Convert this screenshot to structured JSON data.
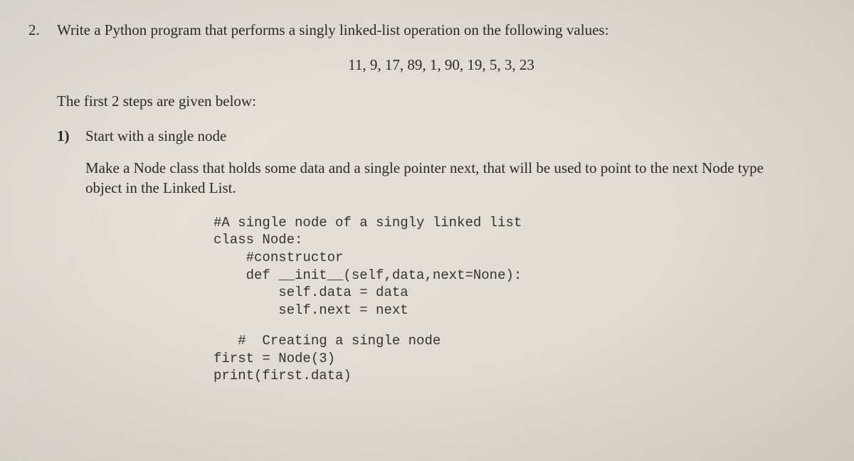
{
  "question": {
    "number": "2.",
    "text": "Write a Python program that performs a singly linked-list operation on the following values:"
  },
  "values": "11, 9, 17, 89, 1, 90, 19, 5, 3, 23",
  "intro": "The first 2 steps are given below:",
  "step1": {
    "number": "1)",
    "title": "Start with a single node",
    "description": "Make a Node class that holds some data and a single pointer next, that will be used to point to the next Node type object in the Linked List."
  },
  "code1": "#A single node of a singly linked list\nclass Node:\n    #constructor\n    def __init__(self,data,next=None):\n        self.data = data\n        self.next = next",
  "code2": "   #  Creating a single node\nfirst = Node(3)\nprint(first.data)"
}
